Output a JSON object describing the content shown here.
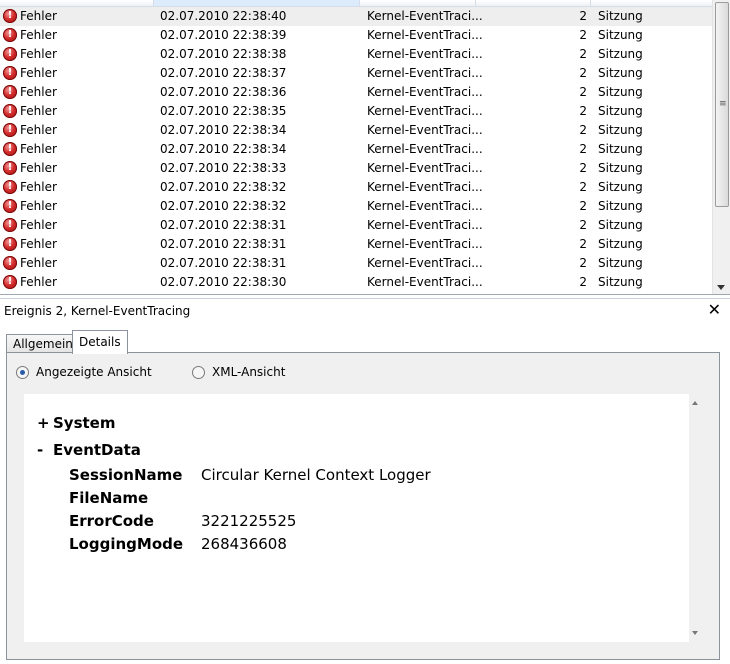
{
  "event_list": {
    "rows": [
      {
        "level": "Fehler",
        "date": "02.07.2010 22:38:40",
        "source": "Kernel-EventTraci...",
        "id": "2",
        "task": "Sitzung",
        "selected": true
      },
      {
        "level": "Fehler",
        "date": "02.07.2010 22:38:39",
        "source": "Kernel-EventTraci...",
        "id": "2",
        "task": "Sitzung"
      },
      {
        "level": "Fehler",
        "date": "02.07.2010 22:38:38",
        "source": "Kernel-EventTraci...",
        "id": "2",
        "task": "Sitzung"
      },
      {
        "level": "Fehler",
        "date": "02.07.2010 22:38:37",
        "source": "Kernel-EventTraci...",
        "id": "2",
        "task": "Sitzung"
      },
      {
        "level": "Fehler",
        "date": "02.07.2010 22:38:36",
        "source": "Kernel-EventTraci...",
        "id": "2",
        "task": "Sitzung"
      },
      {
        "level": "Fehler",
        "date": "02.07.2010 22:38:35",
        "source": "Kernel-EventTraci...",
        "id": "2",
        "task": "Sitzung"
      },
      {
        "level": "Fehler",
        "date": "02.07.2010 22:38:34",
        "source": "Kernel-EventTraci...",
        "id": "2",
        "task": "Sitzung"
      },
      {
        "level": "Fehler",
        "date": "02.07.2010 22:38:34",
        "source": "Kernel-EventTraci...",
        "id": "2",
        "task": "Sitzung"
      },
      {
        "level": "Fehler",
        "date": "02.07.2010 22:38:33",
        "source": "Kernel-EventTraci...",
        "id": "2",
        "task": "Sitzung"
      },
      {
        "level": "Fehler",
        "date": "02.07.2010 22:38:32",
        "source": "Kernel-EventTraci...",
        "id": "2",
        "task": "Sitzung"
      },
      {
        "level": "Fehler",
        "date": "02.07.2010 22:38:32",
        "source": "Kernel-EventTraci...",
        "id": "2",
        "task": "Sitzung"
      },
      {
        "level": "Fehler",
        "date": "02.07.2010 22:38:31",
        "source": "Kernel-EventTraci...",
        "id": "2",
        "task": "Sitzung"
      },
      {
        "level": "Fehler",
        "date": "02.07.2010 22:38:31",
        "source": "Kernel-EventTraci...",
        "id": "2",
        "task": "Sitzung"
      },
      {
        "level": "Fehler",
        "date": "02.07.2010 22:38:31",
        "source": "Kernel-EventTraci...",
        "id": "2",
        "task": "Sitzung"
      },
      {
        "level": "Fehler",
        "date": "02.07.2010 22:38:30",
        "source": "Kernel-EventTraci...",
        "id": "2",
        "task": "Sitzung"
      }
    ],
    "error_icon_glyph": "!",
    "scroll_grip_glyph": "≡"
  },
  "detail": {
    "title": "Ereignis 2, Kernel-EventTracing",
    "close_glyph": "✕",
    "tabs": {
      "general": "Allgemein",
      "details": "Details"
    },
    "view_options": {
      "friendly": "Angezeigte Ansicht",
      "xml": "XML-Ansicht",
      "selected": "friendly"
    },
    "system_node": {
      "sign": "+",
      "label": "System"
    },
    "eventdata_node": {
      "sign": "-",
      "label": "EventData"
    },
    "fields": [
      {
        "name": "SessionName",
        "value": "Circular Kernel Context Logger"
      },
      {
        "name": "FileName",
        "value": ""
      },
      {
        "name": "ErrorCode",
        "value": "3221225525"
      },
      {
        "name": "LoggingMode",
        "value": "268436608"
      }
    ]
  },
  "colors": {
    "error_red": "#d22a2a",
    "selection": "#eeeeee",
    "panel_bg": "#f0f0f0"
  }
}
